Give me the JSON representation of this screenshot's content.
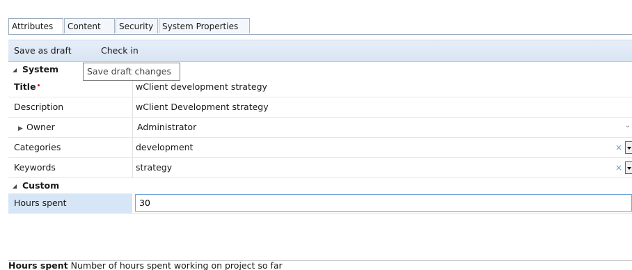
{
  "tabs": [
    {
      "label": "Attributes",
      "active": true
    },
    {
      "label": "Content",
      "active": false
    },
    {
      "label": "Security",
      "active": false
    },
    {
      "label": "System Properties",
      "active": false
    }
  ],
  "toolbar": {
    "save_draft_label": "Save as draft",
    "check_in_label": "Check in"
  },
  "tooltip": {
    "text": "Save draft changes"
  },
  "sections": {
    "system": {
      "label": "System"
    },
    "custom": {
      "label": "Custom"
    }
  },
  "fields": {
    "title": {
      "label": "Title",
      "required_mark": "•",
      "value": "wClient development strategy"
    },
    "description": {
      "label": "Description",
      "value": "wClient Development strategy"
    },
    "owner": {
      "label": "Owner",
      "value": "Administrator"
    },
    "categories": {
      "label": "Categories",
      "value": "development",
      "clear": "×"
    },
    "keywords": {
      "label": "Keywords",
      "value": "strategy",
      "clear": "×"
    },
    "hours_spent": {
      "label": "Hours spent",
      "value": "30"
    }
  },
  "status": {
    "field_name": "Hours spent",
    "description": "Number of hours spent working on project so far"
  },
  "icons": {
    "collapse": "◢",
    "expand": "▶",
    "chevron": "⌄"
  },
  "colors": {
    "toolbar_bg": "#dfe8f4",
    "selected_row": "#d7e6f7",
    "input_border": "#6fa6d9",
    "required": "#d01b1b"
  }
}
